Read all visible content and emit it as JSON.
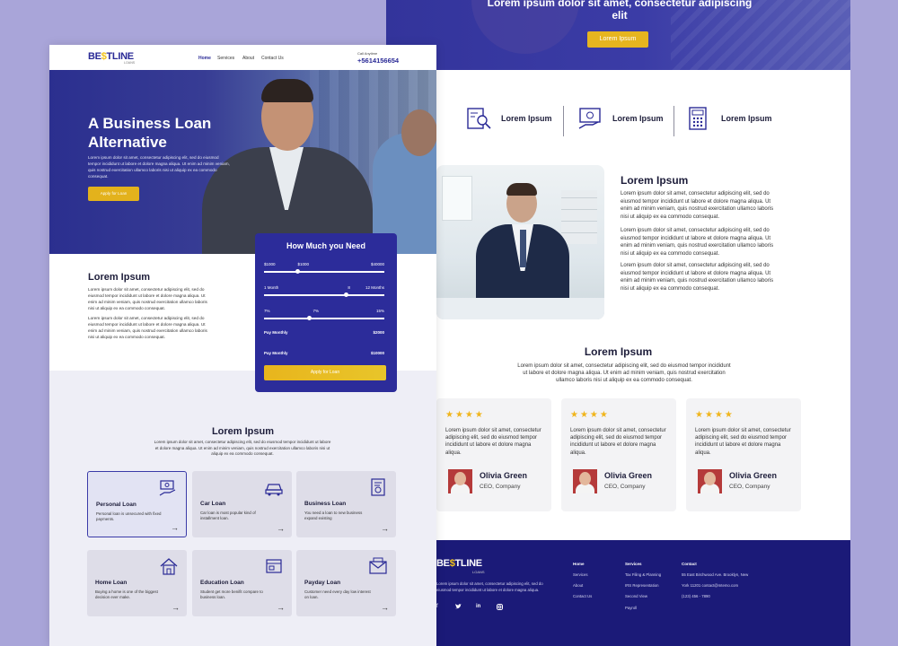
{
  "colors": {
    "accent": "#2a2a96",
    "gold": "#e3b21c",
    "background": "#a9a5d9",
    "footer": "#1b1a78"
  },
  "right": {
    "hero": {
      "title": "Lorem ipsum dolor sit amet, consectetur adipiscing elit",
      "button": "Lorem Ipsum"
    },
    "features": [
      {
        "icon": "search-document-icon",
        "label": "Lorem Ipsum"
      },
      {
        "icon": "money-hand-icon",
        "label": "Lorem Ipsum"
      },
      {
        "icon": "calculator-icon",
        "label": "Lorem Ipsum"
      }
    ],
    "about": {
      "title": "Lorem Ipsum",
      "p1": "Lorem ipsum dolor sit amet, consectetur adipiscing elit, sed do eiusmod tempor incididunt ut labore et dolore magna aliqua. Ut enim ad minim veniam, quis nostrud exercitation ullamco laboris nisi ut aliquip ex ea commodo consequat.",
      "p2": "Lorem ipsum dolor sit amet, consectetur adipiscing elit, sed do eiusmod tempor incididunt ut labore et dolore magna aliqua. Ut enim ad minim veniam, quis nostrud exercitation ullamco laboris nisi ut aliquip ex ea commodo consequat.",
      "p3": "Lorem ipsum dolor sit amet, consectetur adipiscing elit, sed do eiusmod tempor incididunt ut labore et dolore magna aliqua. Ut enim ad minim veniam, quis nostrud exercitation ullamco laboris nisi ut aliquip ex ea commodo consequat."
    },
    "testimonials": {
      "title": "Lorem Ipsum",
      "text": "Lorem ipsum dolor sit amet, consectetur adipiscing elit, sed do eiusmod tempor incididunt ut labore et dolore magna aliqua. Ut enim ad minim veniam, quis nostrud exercitation ullamco laboris nisi ut aliquip ex ea commodo consequat.",
      "stars": "★★★★",
      "cards": [
        {
          "text": "Lorem ipsum dolor sit amet, consectetur adipiscing elit, sed do eiusmod tempor incididunt ut labore et dolore magna aliqua.",
          "name": "Olivia Green",
          "role": "CEO, Company"
        },
        {
          "text": "Lorem ipsum dolor sit amet, consectetur adipiscing elit, sed do eiusmod tempor incididunt ut labore et dolore magna aliqua.",
          "name": "Olivia Green",
          "role": "CEO, Company"
        },
        {
          "text": "Lorem ipsum dolor sit amet, consectetur adipiscing elit, sed do eiusmod tempor incididunt ut labore et dolore magna aliqua.",
          "name": "Olivia Green",
          "role": "CEO, Company"
        }
      ]
    },
    "footer": {
      "logo_a": "BE",
      "logo_s": "$",
      "logo_b": "TLINE",
      "logo_sub": "LOANS",
      "text": "Lorem ipsum dolor sit amet, consectetur adipiscing elit, sed do eiusmod tempor incididunt ut labore et dolore magna aliqua.",
      "col1": {
        "heading": "Home",
        "items": [
          "Services",
          "About",
          "Contact Us"
        ]
      },
      "col2": {
        "heading": "Services",
        "items": [
          "Tax Filing & Planning",
          "IRS Representation",
          "Second View",
          "Payroll"
        ]
      },
      "col3": {
        "heading": "Contact",
        "items": [
          "55 East Birchwood Ave. Brooklyn, New",
          "York 11201 contact@mtemo.com",
          "(123) 456 - 7890"
        ]
      },
      "social": [
        "f",
        "twitter-icon",
        "in",
        "instagram-icon"
      ]
    }
  },
  "left": {
    "header": {
      "logo_a": "BE",
      "logo_s": "$",
      "logo_b": "TLINE",
      "logo_sub": "LOANS",
      "nav": [
        "Home",
        "Services",
        "About",
        "Contact Us"
      ],
      "call_label": "Call Anytime",
      "phone": "+5614156654"
    },
    "hero": {
      "title": "A Business Loan Alternative",
      "text": "Lorem ipsum dolor sit amet, consectetur adipiscing elit, sed do eiusmod tempor incididunt ut labore et dolore magna aliqua. Ut enim ad minim veniam, quis nostrud exercitation ullamco laboris nisi ut aliquip ex ea commodo consequat.",
      "button": "Apply for Loan"
    },
    "about": {
      "title": "Lorem Ipsum",
      "p1": "Lorem ipsum dolor sit amet, consectetur adipiscing elit, sed do eiusmod tempor incididunt ut labore et dolore magna aliqua. Ut enim ad minim veniam, quis nostrud exercitation ullamco laboris nisi ut aliquip ex ea commodo consequat.",
      "p2": "Lorem ipsum dolor sit amet, consectetur adipiscing elit, sed do eiusmod tempor incididunt ut labore et dolore magna aliqua. Ut enim ad minim veniam, quis nostrud exercitation ullamco laboris nisi ut aliquip ex ea commodo consequat."
    },
    "calculator": {
      "title": "How Much you Need",
      "amount": {
        "min": "$1000",
        "value": "$1000",
        "max": "$40000",
        "level": 0.28
      },
      "term": {
        "min": "1 Month",
        "value": "8",
        "max": "12 Months",
        "level": 0.68
      },
      "rate": {
        "min": "7%",
        "value": "7%",
        "max": "15%",
        "level": 0.38
      },
      "pay_monthly_label": "Pay Monthly",
      "pay_monthly_value": "$2000",
      "pay_total_label": "Pay Monthly",
      "pay_total_value": "$10000",
      "button": "Apply for Loan"
    },
    "services": {
      "title": "Lorem Ipsum",
      "text": "Lorem ipsum dolor sit amet, consectetur adipiscing elit, sed do eiusmod tempor incididunt ut labore et dolore magna aliqua. Ut enim ad minim veniam, quis nostrud exercitation ullamco laboris nisi ut aliquip ex ea commodo consequat.",
      "items": [
        {
          "title": "Personal Loan",
          "desc": "Personal loan is unsecured with fixed payments.",
          "icon": "cash-hand-icon",
          "active": true
        },
        {
          "title": "Car Loan",
          "desc": "Car loan is most popular kind of installment loan.",
          "icon": "car-icon",
          "active": false
        },
        {
          "title": "Business Loan",
          "desc": "You need a loan to new business expand existing",
          "icon": "business-document-icon",
          "active": false
        },
        {
          "title": "Home Loan",
          "desc": "Buying a home is one of the biggest decision ever make.",
          "icon": "home-icon",
          "active": false
        },
        {
          "title": "Education Loan",
          "desc": "Student get more benifit compare to business loan.",
          "icon": "education-card-icon",
          "active": false
        },
        {
          "title": "Payday Loan",
          "desc": "Customer need every day low interest on loan.",
          "icon": "envelope-icon",
          "active": false
        }
      ]
    }
  }
}
